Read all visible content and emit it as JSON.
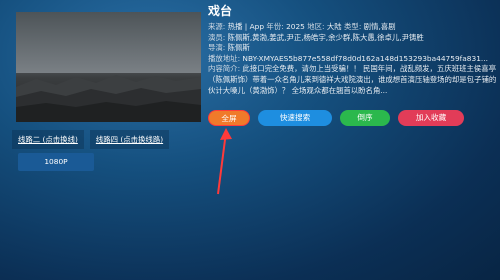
{
  "show": {
    "title": "戏台",
    "source_label": "来源:",
    "source": "热播 | App",
    "year_label": "年份:",
    "year": "2025",
    "region_label": "地区:",
    "region": "大陆",
    "genre_label": "类型:",
    "genre": "剧情,喜剧",
    "cast_label": "演员:",
    "cast": "陈佩斯,黄渤,姜武,尹正,杨皓宇,余少群,陈大愚,徐卓儿,尹铸胜",
    "director_label": "导演:",
    "director": "陈佩斯",
    "url_label": "播放地址:",
    "url": "NBY-XMYAES5b877e558df78d0d162a148d153293ba44759fa831...",
    "summary_label": "内容简介:",
    "summary": "此接口完全免费，请勿上当受骗！！ 民国年间，战乱频发，五庆班班主侯喜亭（陈佩斯饰）带着一众名角儿来到德祥大戏院演出，谁成想首演压轴登场的却是包子铺的伙计大嗓儿（黄渤饰）？ 全场观众都在翘首以盼名角..."
  },
  "actions": {
    "fullscreen": "全屏",
    "quick_search": "快速搜索",
    "reverse": "倒序",
    "favorite": "加入收藏"
  },
  "routes": [
    "线路二 (点击换线)",
    "线路四 (点击换线路)"
  ],
  "episodes": [
    "1080P"
  ],
  "colors": {
    "fullscreen": "#f07a2a",
    "quick_search": "#1e8ee0",
    "reverse": "#2bb84d",
    "favorite": "#e23c58",
    "annotation": "#ff3a3a"
  }
}
